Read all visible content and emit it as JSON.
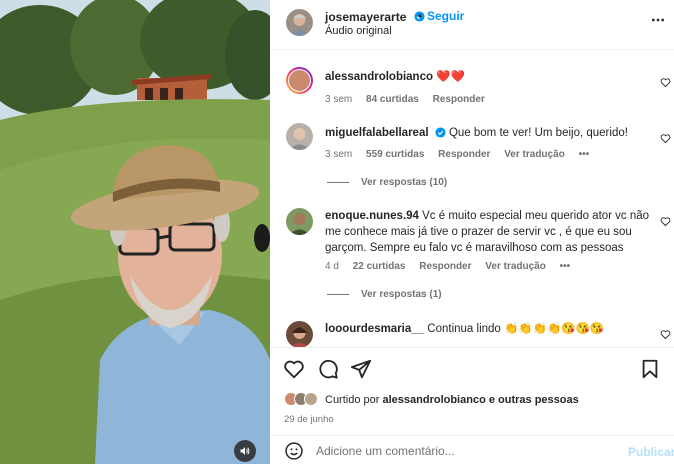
{
  "post": {
    "username": "josemayerarte",
    "separator": "•",
    "follow_label": "Seguir",
    "audio_label": "Áudio original"
  },
  "comments": [
    {
      "username": "alessandrolobianco",
      "text": "❤️❤️",
      "time": "3 sem",
      "likes": "84 curtidas",
      "reply": "Responder"
    },
    {
      "username": "miguelfalabellareal",
      "text": "Que bom te ver! Um beijo, querido!",
      "time": "3 sem",
      "likes": "559 curtidas",
      "reply": "Responder",
      "translate": "Ver tradução",
      "more": "•••",
      "view_replies": "Ver respostas (10)"
    },
    {
      "username": "enoque.nunes.94",
      "text": "Vc é muito especial meu querido ator vc não me conhece mais já tive o prazer de servir vc , é que eu sou garçom. Sempre eu falo vc é maravilhoso com as pessoas",
      "time": "4 d",
      "likes": "22 curtidas",
      "reply": "Responder",
      "translate": "Ver tradução",
      "more": "•••",
      "view_replies": "Ver respostas (1)"
    },
    {
      "username": "looourdesmaria__",
      "text": "Continua lindo 👏👏👏👏😘😘😘"
    }
  ],
  "actions": {
    "liked_prefix": "Curtido por",
    "liked_user": "alessandrolobianco",
    "liked_suffix": "e outras pessoas",
    "date": "29 de junho",
    "comment_placeholder": "Adicione um comentário...",
    "publish_label": "Publicar"
  },
  "colors": {
    "accent": "#0095f6",
    "verified": "#0095f6",
    "muted_text": "#737373"
  },
  "icons": [
    "more-icon",
    "heart-icon",
    "comment-icon",
    "share-icon",
    "bookmark-icon",
    "emoji-icon",
    "mute-icon",
    "verified-badge-icon"
  ]
}
